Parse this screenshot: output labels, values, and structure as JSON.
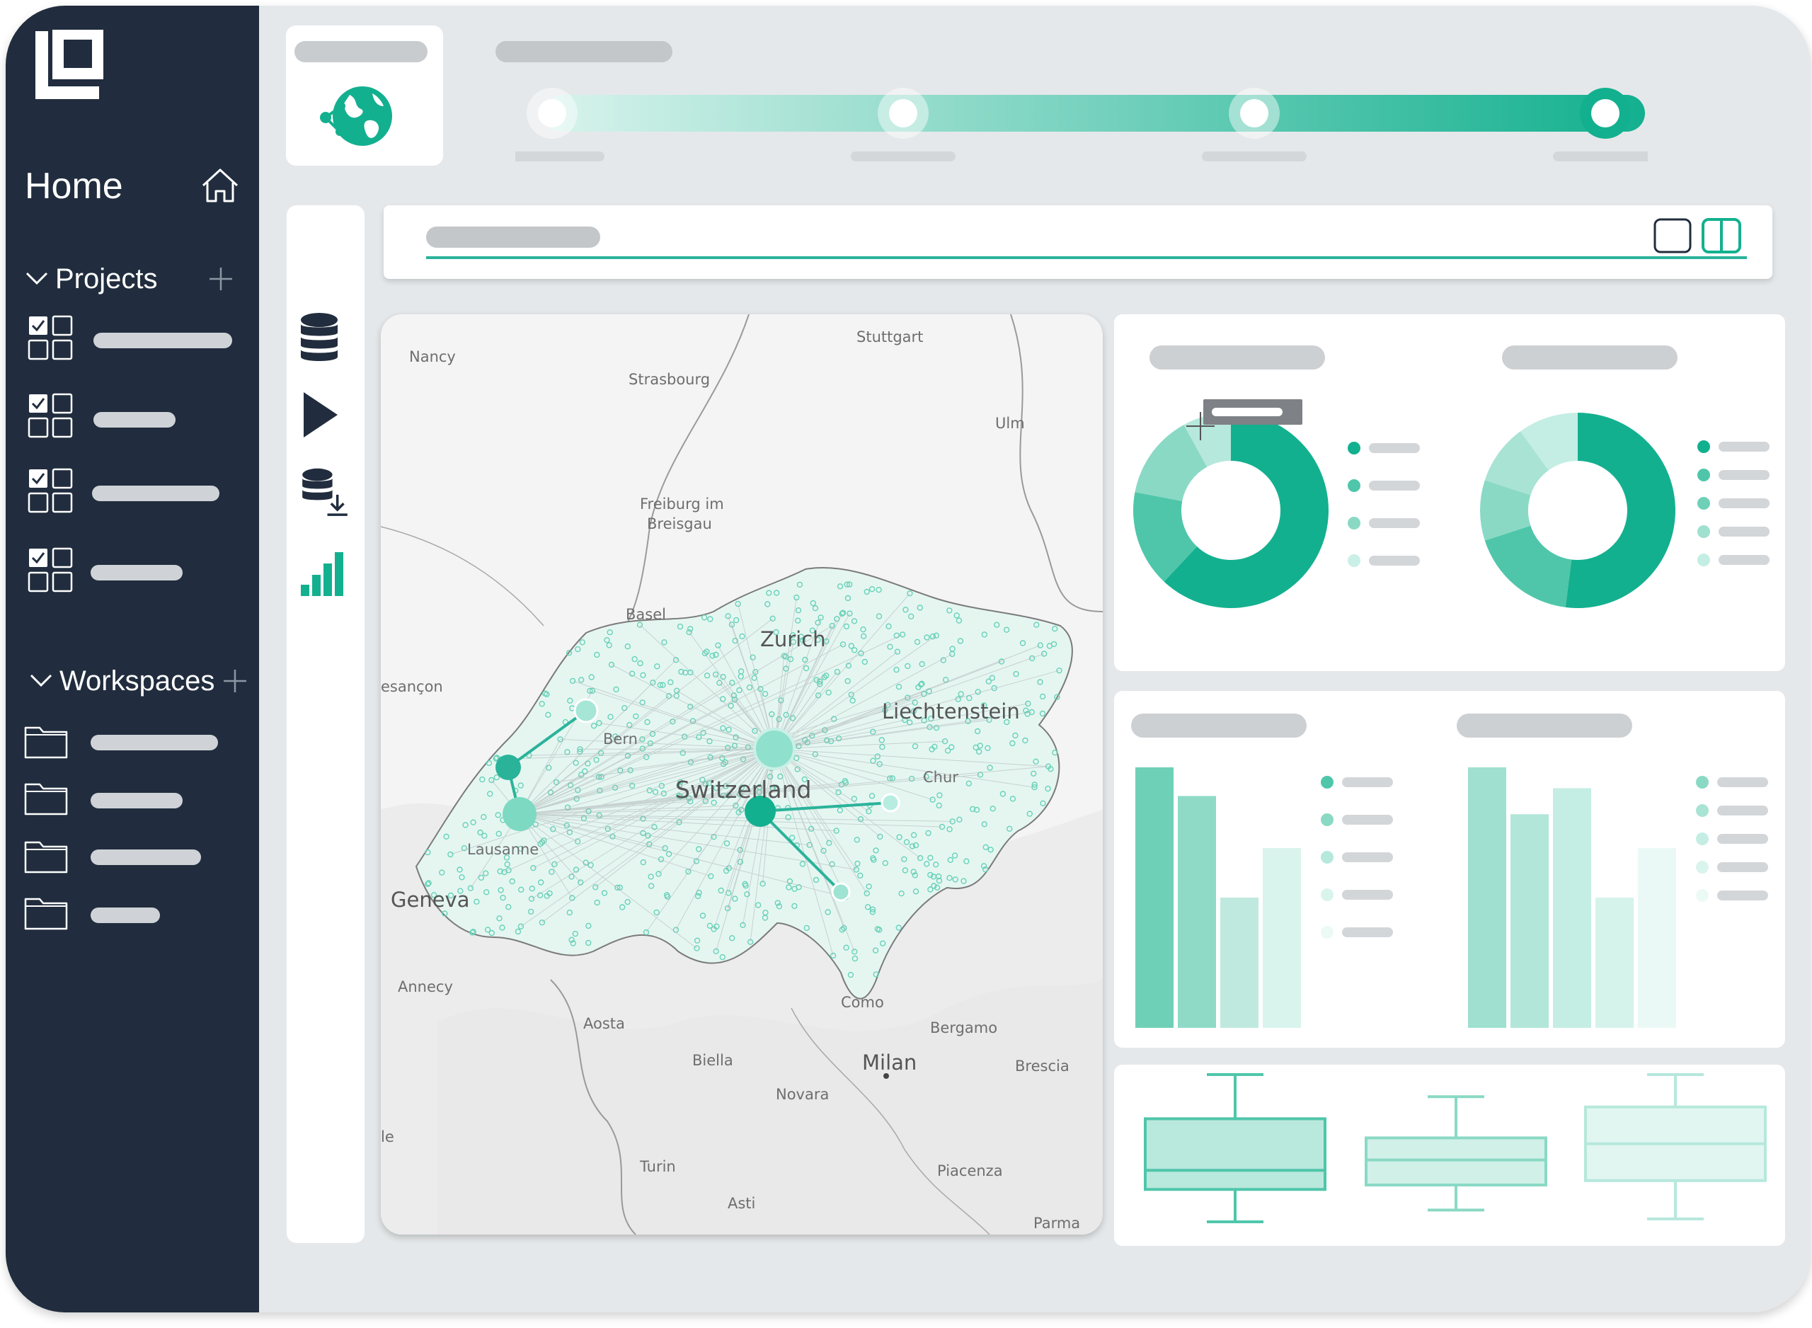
{
  "sidebar": {
    "home_label": "Home",
    "projects_label": "Projects",
    "workspaces_label": "Workspaces",
    "project_items": [
      {
        "checked": true
      },
      {
        "checked": true
      },
      {
        "checked": true
      },
      {
        "checked": true
      }
    ],
    "workspace_count": 4
  },
  "icons": {
    "logo": "logo-icon",
    "home": "home-icon",
    "add": "plus-icon",
    "collapse": "chevron-down-icon",
    "project": "checklist-grid-icon",
    "workspace": "folder-icon",
    "brand": "globe-network-icon",
    "toolbar": [
      "database-icon",
      "play-icon",
      "database-download-icon",
      "signal-bars-icon"
    ],
    "view_modes": [
      "single-pane-icon",
      "split-pane-icon"
    ]
  },
  "stepper": {
    "steps": 4,
    "current_step": 4
  },
  "map": {
    "labels": {
      "nancy": "Nancy",
      "strasbourg": "Strasbourg",
      "stuttgart": "Stuttgart",
      "ulm": "Ulm",
      "freiburg1": "Freiburg im",
      "freiburg2": "Breisgau",
      "basel": "Basel",
      "zurich": "Zurich",
      "besancon": "esançon",
      "liechtenstein": "Liechtenstein",
      "bern": "Bern",
      "switzerland": "Switzerland",
      "chur": "Chur",
      "lausanne": "Lausanne",
      "geneva": "Geneva",
      "annecy": "Annecy",
      "aosta": "Aosta",
      "biella": "Biella",
      "como": "Como",
      "bergamo": "Bergamo",
      "milan": "Milan",
      "brescia": "Brescia",
      "novara": "Novara",
      "turin": "Turin",
      "piacenza": "Piacenza",
      "asti": "Asti",
      "parma": "Parma",
      "le": "le"
    }
  },
  "colors": {
    "accent": "#13b08f",
    "sidebar": "#212d3e",
    "background": "#e5e8ea",
    "teal_shades": [
      "#13b08f",
      "#4fc6aa",
      "#8ad9c5",
      "#b6e8dc",
      "#d9f4ec",
      "#ecfaf6"
    ]
  },
  "chart_data": [
    {
      "type": "pie",
      "variant": "donut",
      "values": [
        62,
        16,
        14,
        8
      ],
      "colors": [
        "#13b08f",
        "#4fc6aa",
        "#8ad9c5",
        "#b6e8dc"
      ]
    },
    {
      "type": "pie",
      "variant": "donut",
      "values": [
        52,
        18,
        10,
        10,
        10
      ],
      "colors": [
        "#13b08f",
        "#4fc6aa",
        "#8ad9c5",
        "#a8e3d4",
        "#c4eee3"
      ]
    },
    {
      "type": "bar",
      "values": [
        100,
        89,
        50,
        69
      ],
      "colors": [
        "#6fd0b8",
        "#8fdac7",
        "#bfe9de",
        "#d9f4ec"
      ],
      "ylim": [
        0,
        100
      ]
    },
    {
      "type": "bar",
      "values": [
        100,
        82,
        92,
        50,
        69
      ],
      "colors": [
        "#9fe0d0",
        "#b2e6d9",
        "#c4ede3",
        "#d6f3eb",
        "#eaf9f5"
      ],
      "ylim": [
        0,
        100
      ]
    },
    {
      "type": "box",
      "boxes": [
        {
          "whisker_low": 0,
          "q1": 22,
          "median": 35,
          "q3": 70,
          "whisker_high": 100,
          "color": "#4fc6aa"
        },
        {
          "whisker_low": 8,
          "q1": 25,
          "median": 42,
          "q3": 57,
          "whisker_high": 85,
          "color": "#8ad9c5"
        },
        {
          "whisker_low": 2,
          "q1": 28,
          "median": 53,
          "q3": 78,
          "whisker_high": 100,
          "color": "#b6e8dc"
        }
      ]
    }
  ]
}
